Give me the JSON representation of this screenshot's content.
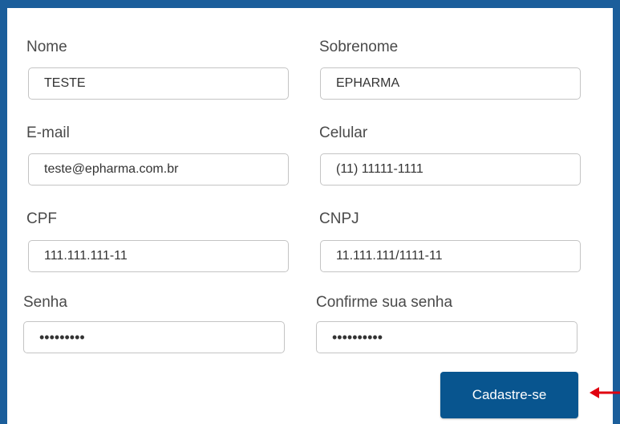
{
  "form": {
    "fields": {
      "nome": {
        "label": "Nome",
        "value": "TESTE"
      },
      "sobrenome": {
        "label": "Sobrenome",
        "value": "EPHARMA"
      },
      "email": {
        "label": "E-mail",
        "value": "teste@epharma.com.br"
      },
      "celular": {
        "label": "Celular",
        "value": "(11) 11111-1111"
      },
      "cpf": {
        "label": "CPF",
        "value": "111.111.111-11"
      },
      "cnpj": {
        "label": "CNPJ",
        "value": "11.111.111/1111-11"
      },
      "senha": {
        "label": "Senha",
        "value": "•••••••••"
      },
      "confirme_senha": {
        "label": "Confirme sua senha",
        "value": "••••••••••"
      }
    },
    "submit_label": "Cadastre-se"
  },
  "colors": {
    "frame_blue": "#1b5e9b",
    "button_blue": "#08558f",
    "annotation_arrow": "#e0000f"
  },
  "annotation": {
    "icon": "left-arrow-icon"
  }
}
